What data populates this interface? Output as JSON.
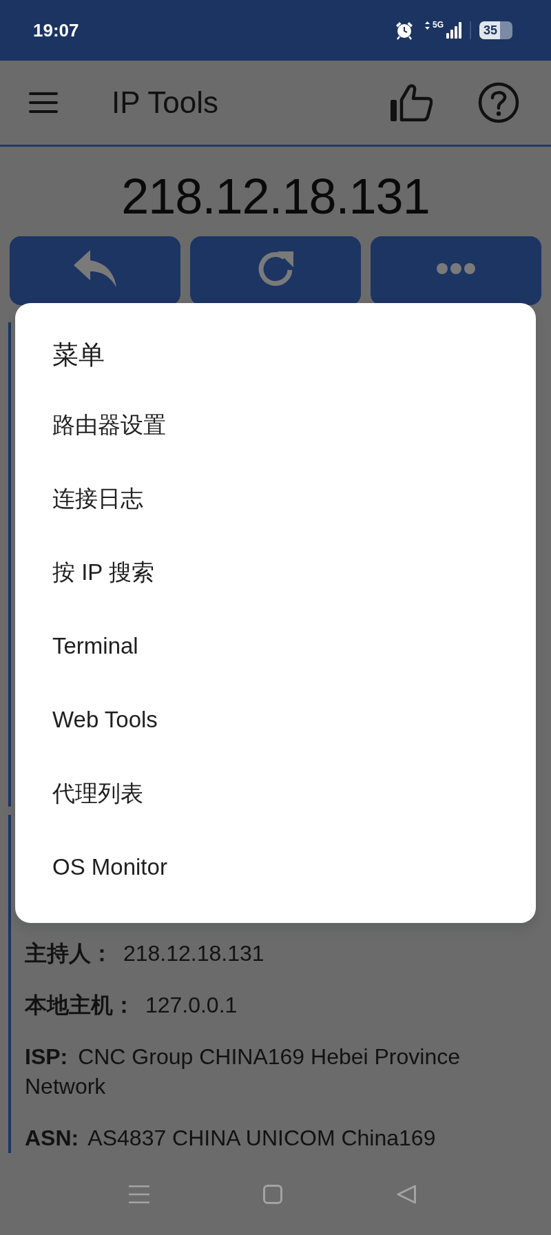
{
  "status_bar": {
    "time": "19:07",
    "network_type": "5G",
    "battery": "35"
  },
  "app_bar": {
    "title": "IP Tools"
  },
  "ip_address": "218.12.18.131",
  "action_buttons": [
    {
      "kind": "back"
    },
    {
      "kind": "refresh"
    },
    {
      "kind": "more"
    }
  ],
  "info_rows": [
    {
      "label": "主持人：",
      "value": "218.12.18.131"
    },
    {
      "label": "本地主机：",
      "value": "127.0.0.1"
    },
    {
      "label": "ISP:",
      "value": "CNC Group CHINA169 Hebei Province Network"
    },
    {
      "label": "ASN:",
      "value": "AS4837 CHINA UNICOM China169"
    }
  ],
  "menu_dialog": {
    "title": "菜单",
    "items": [
      "路由器设置",
      "连接日志",
      "按 IP 搜索",
      "Terminal",
      "Web Tools",
      "代理列表",
      "OS Monitor"
    ]
  }
}
